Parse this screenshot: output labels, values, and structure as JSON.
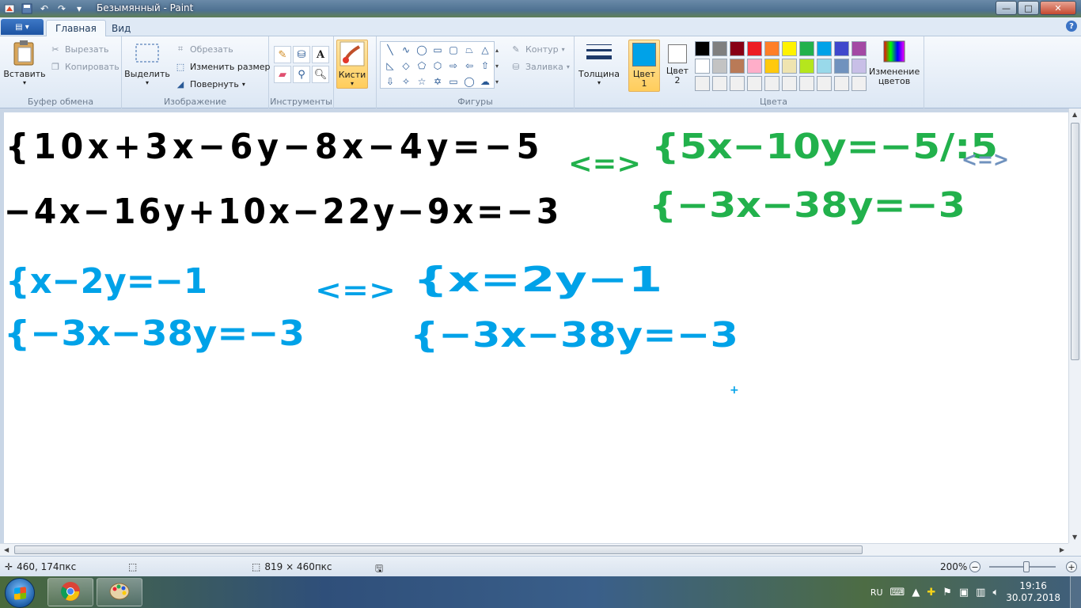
{
  "window": {
    "title": "Безымянный - Paint",
    "buttons": {
      "minimize": "—",
      "maximize": "□",
      "close": "✕"
    }
  },
  "tabs": [
    {
      "label": "Главная",
      "active": true
    },
    {
      "label": "Вид",
      "active": false
    }
  ],
  "ribbon": {
    "clipboard": {
      "paste": "Вставить",
      "cut": "Вырезать",
      "copy": "Копировать",
      "label": "Буфер обмена"
    },
    "image": {
      "select": "Выделить",
      "crop": "Обрезать",
      "resize": "Изменить размер",
      "rotate": "Повернуть",
      "label": "Изображение"
    },
    "tools": {
      "label": "Инструменты"
    },
    "brushes": {
      "label": "Кисти"
    },
    "shapes": {
      "outline": "Контур",
      "fill": "Заливка",
      "label": "Фигуры"
    },
    "size": {
      "label": "Толщина"
    },
    "colors": {
      "color1": "Цвет 1",
      "color2": "Цвет 2",
      "color1_value": "#00a2e8",
      "color2_value": "#ffffff",
      "edit": "Изменение цветов",
      "label": "Цвета",
      "palette_row1": [
        "#000000",
        "#7f7f7f",
        "#880015",
        "#ed1c24",
        "#ff7f27",
        "#fff200",
        "#22b14c",
        "#00a2e8",
        "#3f48cc",
        "#a349a4"
      ],
      "palette_row2": [
        "#ffffff",
        "#c3c3c3",
        "#b97a57",
        "#ffaec9",
        "#ffc90e",
        "#efe4b0",
        "#b5e61d",
        "#99d9ea",
        "#7092be",
        "#c8bfe7"
      ],
      "palette_row3": [
        "#f0f0f0",
        "#f0f0f0",
        "#f0f0f0",
        "#f0f0f0",
        "#f0f0f0",
        "#f0f0f0",
        "#f0f0f0",
        "#f0f0f0",
        "#f0f0f0",
        "#f0f0f0"
      ]
    }
  },
  "canvas": {
    "ink_black": "#000000",
    "ink_green": "#22b14c",
    "ink_blue": "#00a2e8",
    "ink_grayblue": "#7092be",
    "lines": {
      "black1": "{10x+3x−6y−8x−4y=−5",
      "black2": "−4x−16y+10x−22y−9x=−3",
      "arrow1": "<=>",
      "green1": "{5x−10y=−5/:5",
      "green2": "{−3x−38y=−3",
      "grayblue": "<=>",
      "blue1": "{x−2y=−1",
      "blue2": "{−3x−38y=−3",
      "arrow2": "<=>",
      "blue3": "{x=2y−1",
      "blue4": "{−3x−38y=−3",
      "cursor": "+"
    }
  },
  "status": {
    "position": "460, 174пкс",
    "size": "819 × 460пкс",
    "zoom": "200%"
  },
  "taskbar": {
    "lang": "RU",
    "time": "19:16",
    "date": "30.07.2018"
  }
}
